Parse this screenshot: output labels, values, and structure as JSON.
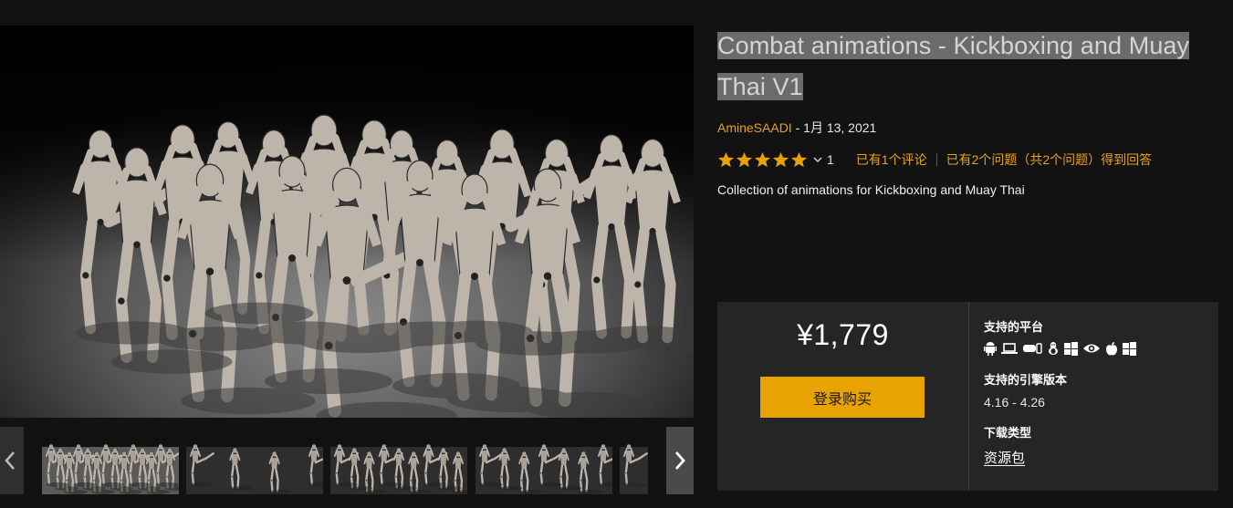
{
  "product": {
    "title": "Combat animations - Kickboxing and Muay Thai V1",
    "author": "AmineSAADI",
    "date_sep": " - ",
    "date": "1月 13, 2021",
    "rating": {
      "stars": 5,
      "count": "1",
      "reviews_link": "已有1个评论",
      "questions_link": "已有2个问题（共2个问题）得到回答"
    },
    "description": "Collection of animations for Kickboxing and Muay Thai"
  },
  "gallery": {
    "hero_image": "mannequin-fighters-kickboxing-scene",
    "thumbnails": [
      {
        "name": "thumbnail-1",
        "selected": true
      },
      {
        "name": "thumbnail-2",
        "selected": false
      },
      {
        "name": "thumbnail-3",
        "selected": false
      },
      {
        "name": "thumbnail-4",
        "selected": false
      },
      {
        "name": "thumbnail-5",
        "selected": false
      }
    ],
    "prev_icon": "chevron-left-icon",
    "next_icon": "chevron-right-icon"
  },
  "purchase": {
    "price": "¥1,779",
    "buy_label": "登录购买",
    "platforms_label": "支持的平台",
    "platform_icons": [
      "android-icon",
      "laptop-icon",
      "vr-headset-icon",
      "linux-icon",
      "windows-icon",
      "eye-icon",
      "apple-icon",
      "windows-icon"
    ],
    "engine_label": "支持的引擎版本",
    "engine_versions": "4.16 - 4.26",
    "download_label": "下载类型",
    "download_type": "资源包"
  },
  "colors": {
    "accent": "#e8a300",
    "link": "#e8a317",
    "background": "#121212",
    "panel": "#252525",
    "title_highlight": "#6b6b6b"
  }
}
